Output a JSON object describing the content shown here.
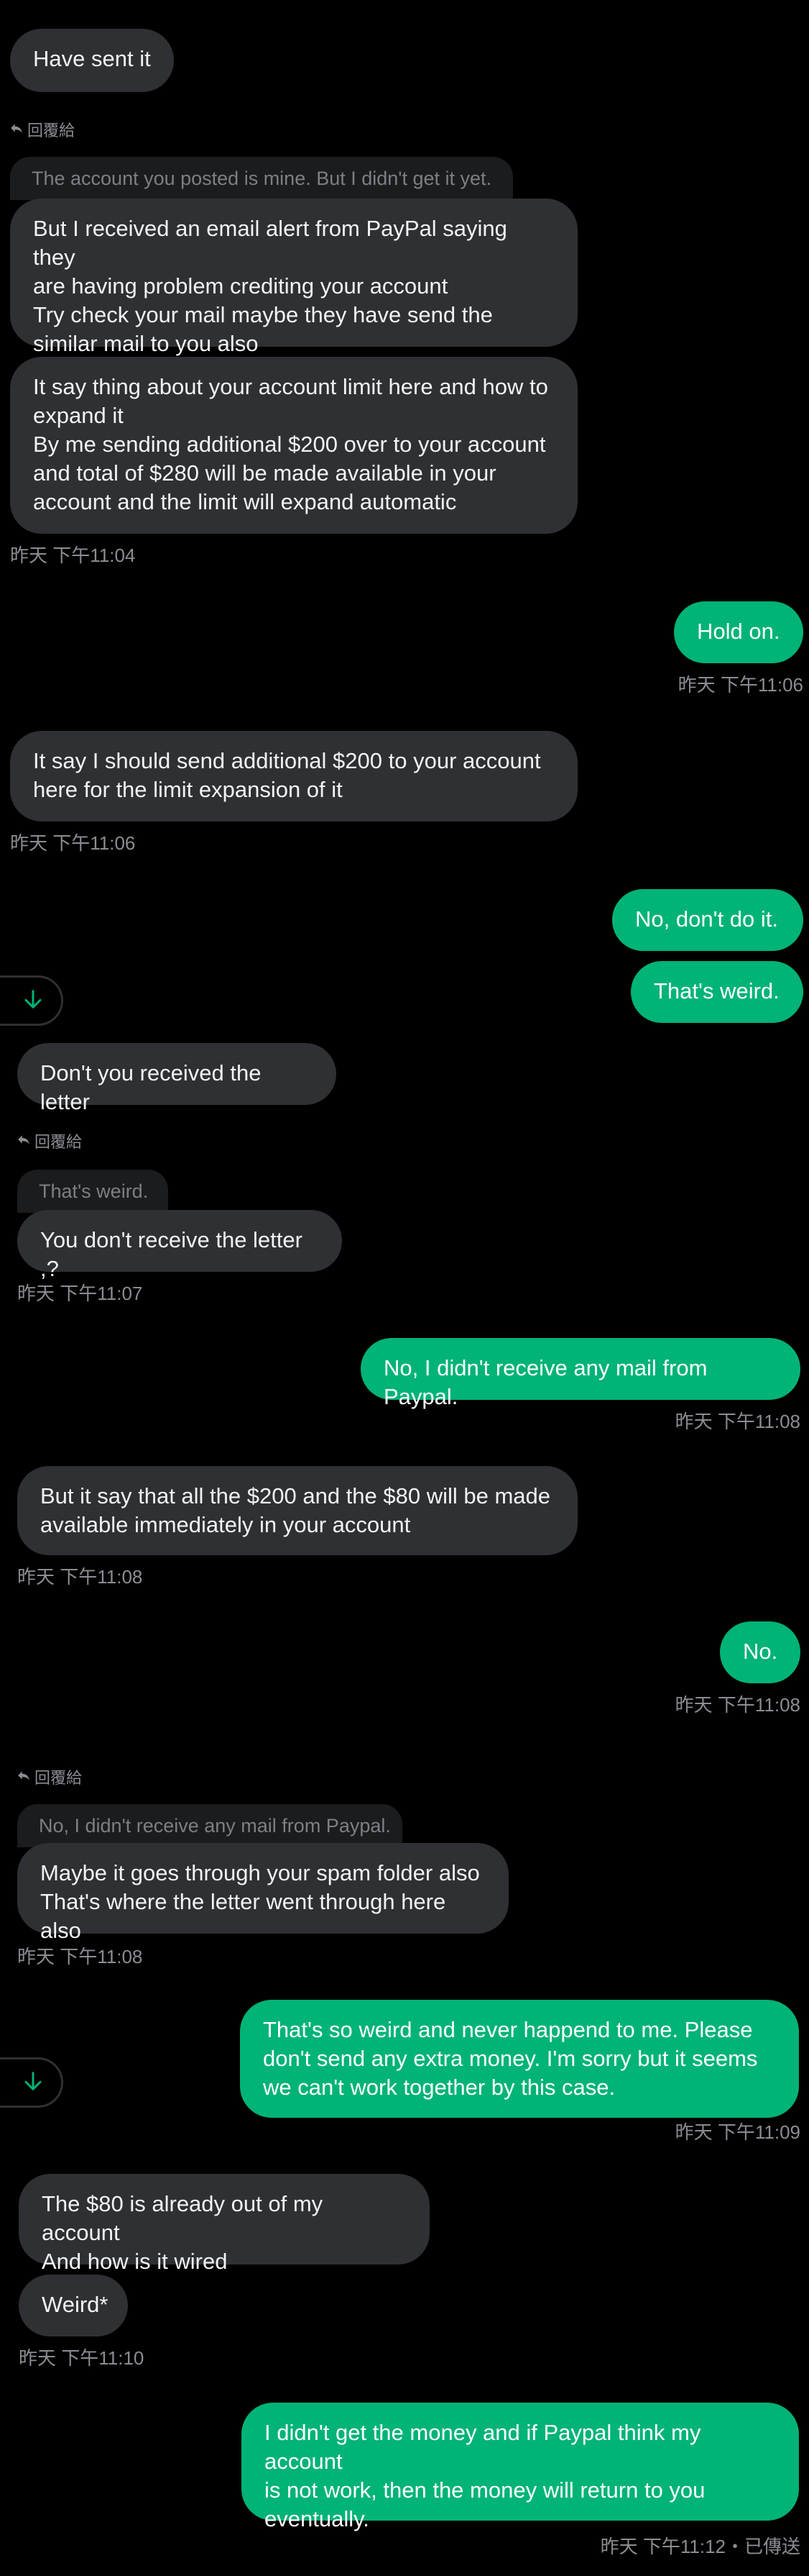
{
  "reply_label": "回覆給",
  "messages": [
    {
      "text": "Have sent it"
    },
    {
      "quote": "The account you posted is mine. But I didn't get it yet."
    },
    {
      "text": "But I received an email alert from PayPal saying they\nare having problem crediting your account\nTry check your mail maybe they have send the\nsimilar mail to you also"
    },
    {
      "text": "It say thing about your account limit here and how to\nexpand it\nBy me sending additional $200 over to your account\nand total of $280 will be made available in your\naccount and the limit will expand automatic"
    },
    {
      "time": "昨天 下午11:04"
    },
    {
      "text": "Hold on."
    },
    {
      "time": "昨天 下午11:06"
    },
    {
      "text": "It say I should send additional $200 to your account\nhere for the limit expansion of it"
    },
    {
      "time": "昨天 下午11:06"
    },
    {
      "text": "No, don't do it."
    },
    {
      "text": "That's weird."
    },
    {
      "text": "Don't you received the letter"
    },
    {
      "quote": "That's weird."
    },
    {
      "text": "You don't receive the letter ,?"
    },
    {
      "time": "昨天 下午11:07"
    },
    {
      "text": "No, I didn't receive any mail from Paypal."
    },
    {
      "time": "昨天 下午11:08"
    },
    {
      "text": "But it say that all the $200 and the $80 will be made\navailable immediately in your account"
    },
    {
      "time": "昨天 下午11:08"
    },
    {
      "text": "No."
    },
    {
      "time": "昨天 下午11:08"
    },
    {
      "quote": "No, I didn't receive any mail from Paypal."
    },
    {
      "text": "Maybe it goes through your spam folder also\nThat's where the letter went through here also"
    },
    {
      "time": "昨天 下午11:08"
    },
    {
      "text": "That's so weird and never happend to me. Please\ndon't send any extra money. I'm sorry but it seems\nwe can't work together by this case."
    },
    {
      "time": "昨天 下午11:09"
    },
    {
      "text": "The $80 is already out of my account\nAnd how is it wired"
    },
    {
      "text": "Weird*"
    },
    {
      "time": "昨天 下午11:10"
    },
    {
      "text": "I didn't get the money and if Paypal think my account\nis not work, then the money will return to you\neventually."
    },
    {
      "time": "昨天 下午11:12・已傳送"
    }
  ],
  "colors": {
    "incoming": "#2f3033",
    "outgoing": "#00b377",
    "background": "#000000"
  },
  "icons": {
    "reply": "reply-arrow-icon",
    "scroll": "arrow-down-icon"
  }
}
